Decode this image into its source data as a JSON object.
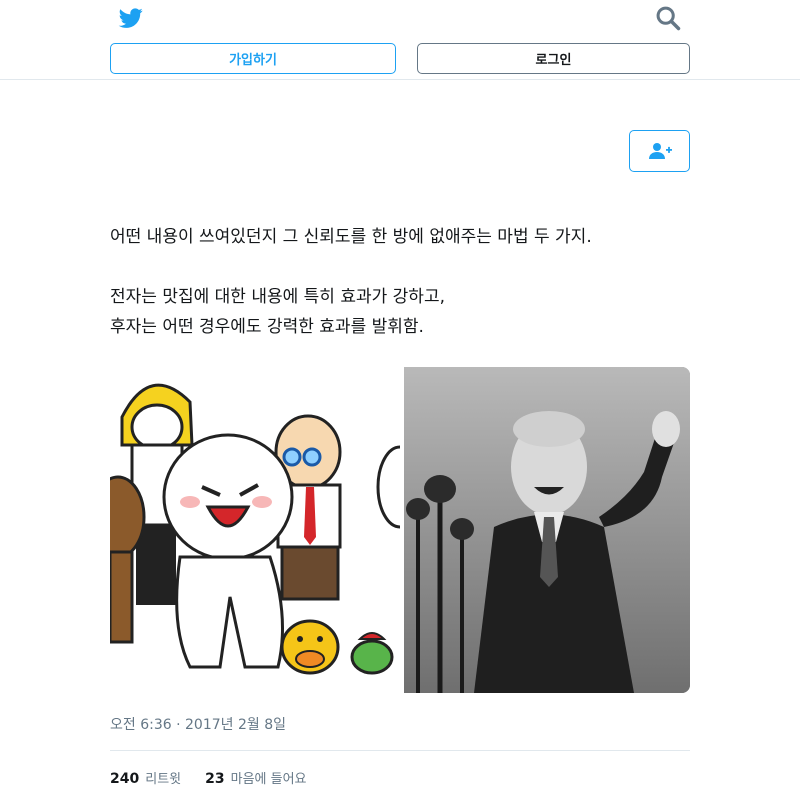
{
  "header": {
    "logo_icon": "twitter-bird-icon",
    "search_icon": "search-icon",
    "signup_label": "가입하기",
    "login_label": "로그인"
  },
  "tweet": {
    "follow_icon": "follow-user-icon",
    "lines": [
      "어떤 내용이 쓰여있던지 그 신뢰도를 한 방에 없애주는 마법 두 가지.",
      "전자는 맛집에 대한 내용에 특히 효과가 강하고,",
      "후자는 어떤 경우에도 강력한 효과를 발휘함."
    ],
    "timestamp": "오전 6:36 · 2017년 2월 8일",
    "retweets_count": "240",
    "retweets_label": "리트윗",
    "likes_count": "23",
    "likes_label": "마음에 들어요"
  },
  "colors": {
    "accent": "#1da1f2",
    "text": "#14171a",
    "muted": "#657786",
    "border": "#e1e8ed"
  }
}
